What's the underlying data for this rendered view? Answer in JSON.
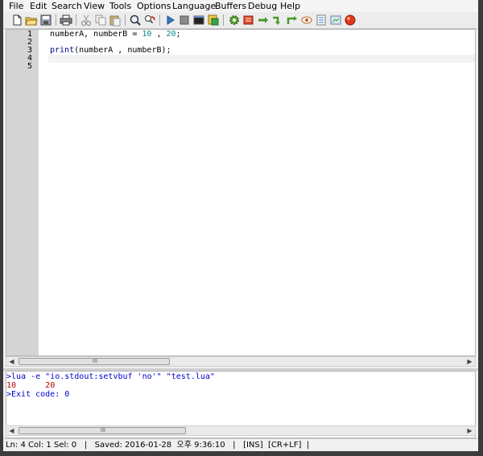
{
  "menu": [
    "File",
    "Edit",
    "Search",
    "View",
    "Tools",
    "Options",
    "Language",
    "Buffers",
    "Debug",
    "Help"
  ],
  "toolbar": {
    "buttons": [
      "new-file",
      "open-file",
      "save-file",
      "print",
      "cut",
      "copy",
      "paste",
      "find",
      "find-replace",
      "run",
      "stop",
      "command-prompt",
      "save-all",
      "compile",
      "debug",
      "next-step",
      "into",
      "return",
      "view",
      "properties",
      "snapshot",
      "stop-debug"
    ]
  },
  "editor": {
    "line_numbers": [
      "1",
      "2",
      "3",
      "4",
      "5"
    ],
    "line1": {
      "a": "numberA, numberB = ",
      "num1": "10",
      "sep": " , ",
      "num2": "20",
      "end": ";"
    },
    "line3": {
      "fn": "print",
      "rest": "(numberA , numberB);"
    }
  },
  "scrollbar": {
    "grip": "III"
  },
  "output": {
    "command": ">lua -e \"io.stdout:setvbuf 'no'\" \"test.lua\"",
    "result": "10\t20",
    "exit": ">Exit code: 0"
  },
  "status": "Ln: 4 Col: 1 Sel: 0   |   Saved: 2016-01-28  오후 9:36:10   |   [INS]  [CR+LF]  |",
  "colors": {
    "command": "#0000cc",
    "result": "#b40000",
    "exit": "#0000cc",
    "number": "#0a8a8a"
  }
}
